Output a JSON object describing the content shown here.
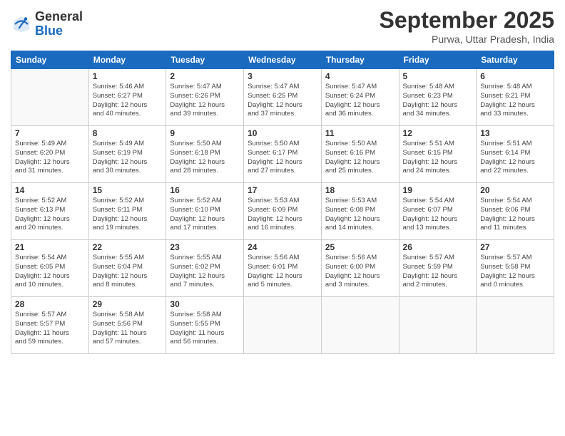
{
  "logo": {
    "general": "General",
    "blue": "Blue"
  },
  "header": {
    "month": "September 2025",
    "location": "Purwa, Uttar Pradesh, India"
  },
  "weekdays": [
    "Sunday",
    "Monday",
    "Tuesday",
    "Wednesday",
    "Thursday",
    "Friday",
    "Saturday"
  ],
  "weeks": [
    [
      {
        "day": "",
        "info": ""
      },
      {
        "day": "1",
        "info": "Sunrise: 5:46 AM\nSunset: 6:27 PM\nDaylight: 12 hours\nand 40 minutes."
      },
      {
        "day": "2",
        "info": "Sunrise: 5:47 AM\nSunset: 6:26 PM\nDaylight: 12 hours\nand 39 minutes."
      },
      {
        "day": "3",
        "info": "Sunrise: 5:47 AM\nSunset: 6:25 PM\nDaylight: 12 hours\nand 37 minutes."
      },
      {
        "day": "4",
        "info": "Sunrise: 5:47 AM\nSunset: 6:24 PM\nDaylight: 12 hours\nand 36 minutes."
      },
      {
        "day": "5",
        "info": "Sunrise: 5:48 AM\nSunset: 6:23 PM\nDaylight: 12 hours\nand 34 minutes."
      },
      {
        "day": "6",
        "info": "Sunrise: 5:48 AM\nSunset: 6:21 PM\nDaylight: 12 hours\nand 33 minutes."
      }
    ],
    [
      {
        "day": "7",
        "info": "Sunrise: 5:49 AM\nSunset: 6:20 PM\nDaylight: 12 hours\nand 31 minutes."
      },
      {
        "day": "8",
        "info": "Sunrise: 5:49 AM\nSunset: 6:19 PM\nDaylight: 12 hours\nand 30 minutes."
      },
      {
        "day": "9",
        "info": "Sunrise: 5:50 AM\nSunset: 6:18 PM\nDaylight: 12 hours\nand 28 minutes."
      },
      {
        "day": "10",
        "info": "Sunrise: 5:50 AM\nSunset: 6:17 PM\nDaylight: 12 hours\nand 27 minutes."
      },
      {
        "day": "11",
        "info": "Sunrise: 5:50 AM\nSunset: 6:16 PM\nDaylight: 12 hours\nand 25 minutes."
      },
      {
        "day": "12",
        "info": "Sunrise: 5:51 AM\nSunset: 6:15 PM\nDaylight: 12 hours\nand 24 minutes."
      },
      {
        "day": "13",
        "info": "Sunrise: 5:51 AM\nSunset: 6:14 PM\nDaylight: 12 hours\nand 22 minutes."
      }
    ],
    [
      {
        "day": "14",
        "info": "Sunrise: 5:52 AM\nSunset: 6:13 PM\nDaylight: 12 hours\nand 20 minutes."
      },
      {
        "day": "15",
        "info": "Sunrise: 5:52 AM\nSunset: 6:11 PM\nDaylight: 12 hours\nand 19 minutes."
      },
      {
        "day": "16",
        "info": "Sunrise: 5:52 AM\nSunset: 6:10 PM\nDaylight: 12 hours\nand 17 minutes."
      },
      {
        "day": "17",
        "info": "Sunrise: 5:53 AM\nSunset: 6:09 PM\nDaylight: 12 hours\nand 16 minutes."
      },
      {
        "day": "18",
        "info": "Sunrise: 5:53 AM\nSunset: 6:08 PM\nDaylight: 12 hours\nand 14 minutes."
      },
      {
        "day": "19",
        "info": "Sunrise: 5:54 AM\nSunset: 6:07 PM\nDaylight: 12 hours\nand 13 minutes."
      },
      {
        "day": "20",
        "info": "Sunrise: 5:54 AM\nSunset: 6:06 PM\nDaylight: 12 hours\nand 11 minutes."
      }
    ],
    [
      {
        "day": "21",
        "info": "Sunrise: 5:54 AM\nSunset: 6:05 PM\nDaylight: 12 hours\nand 10 minutes."
      },
      {
        "day": "22",
        "info": "Sunrise: 5:55 AM\nSunset: 6:04 PM\nDaylight: 12 hours\nand 8 minutes."
      },
      {
        "day": "23",
        "info": "Sunrise: 5:55 AM\nSunset: 6:02 PM\nDaylight: 12 hours\nand 7 minutes."
      },
      {
        "day": "24",
        "info": "Sunrise: 5:56 AM\nSunset: 6:01 PM\nDaylight: 12 hours\nand 5 minutes."
      },
      {
        "day": "25",
        "info": "Sunrise: 5:56 AM\nSunset: 6:00 PM\nDaylight: 12 hours\nand 3 minutes."
      },
      {
        "day": "26",
        "info": "Sunrise: 5:57 AM\nSunset: 5:59 PM\nDaylight: 12 hours\nand 2 minutes."
      },
      {
        "day": "27",
        "info": "Sunrise: 5:57 AM\nSunset: 5:58 PM\nDaylight: 12 hours\nand 0 minutes."
      }
    ],
    [
      {
        "day": "28",
        "info": "Sunrise: 5:57 AM\nSunset: 5:57 PM\nDaylight: 11 hours\nand 59 minutes."
      },
      {
        "day": "29",
        "info": "Sunrise: 5:58 AM\nSunset: 5:56 PM\nDaylight: 11 hours\nand 57 minutes."
      },
      {
        "day": "30",
        "info": "Sunrise: 5:58 AM\nSunset: 5:55 PM\nDaylight: 11 hours\nand 56 minutes."
      },
      {
        "day": "",
        "info": ""
      },
      {
        "day": "",
        "info": ""
      },
      {
        "day": "",
        "info": ""
      },
      {
        "day": "",
        "info": ""
      }
    ]
  ]
}
